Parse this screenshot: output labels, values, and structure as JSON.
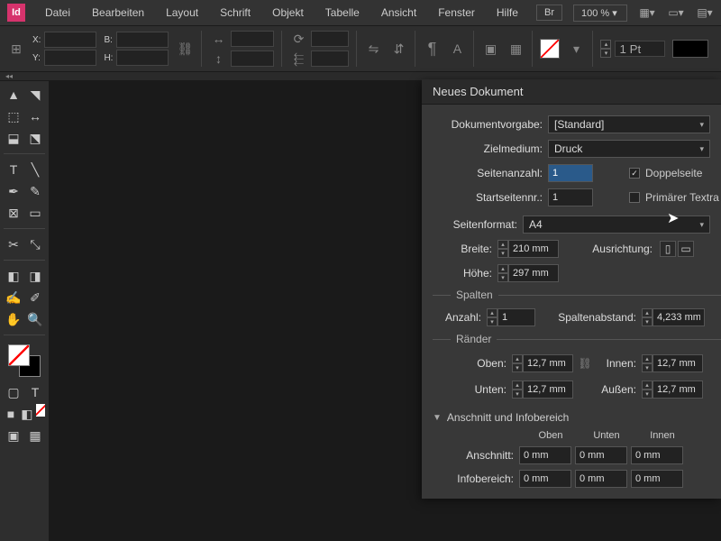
{
  "app": {
    "logo": "Id"
  },
  "menu": {
    "items": [
      "Datei",
      "Bearbeiten",
      "Layout",
      "Schrift",
      "Objekt",
      "Tabelle",
      "Ansicht",
      "Fenster",
      "Hilfe"
    ],
    "br": "Br",
    "zoom": "100 %"
  },
  "control": {
    "x": "X:",
    "y": "Y:",
    "b": "B:",
    "h": "H:",
    "stroke_weight": "1 Pt"
  },
  "dialog": {
    "title": "Neues Dokument",
    "preset_label": "Dokumentvorgabe:",
    "preset_value": "[Standard]",
    "intent_label": "Zielmedium:",
    "intent_value": "Druck",
    "pages_label": "Seitenanzahl:",
    "pages_value": "1",
    "facing_label": "Doppelseite",
    "startpage_label": "Startseitennr.:",
    "startpage_value": "1",
    "primary_label": "Primärer Textra",
    "format_label": "Seitenformat:",
    "format_value": "A4",
    "width_label": "Breite:",
    "width_value": "210 mm",
    "height_label": "Höhe:",
    "height_value": "297 mm",
    "orient_label": "Ausrichtung:",
    "columns_title": "Spalten",
    "col_count_label": "Anzahl:",
    "col_count_value": "1",
    "gutter_label": "Spaltenabstand:",
    "gutter_value": "4,233 mm",
    "margins_title": "Ränder",
    "top_label": "Oben:",
    "bottom_label": "Unten:",
    "inside_label": "Innen:",
    "outside_label": "Außen:",
    "margin_value": "12,7 mm",
    "bleed_title": "Anschnitt und Infobereich",
    "col_top": "Oben",
    "col_bottom": "Unten",
    "col_inside": "Innen",
    "bleed_label": "Anschnitt:",
    "slug_label": "Infobereich:",
    "zero": "0 mm"
  }
}
